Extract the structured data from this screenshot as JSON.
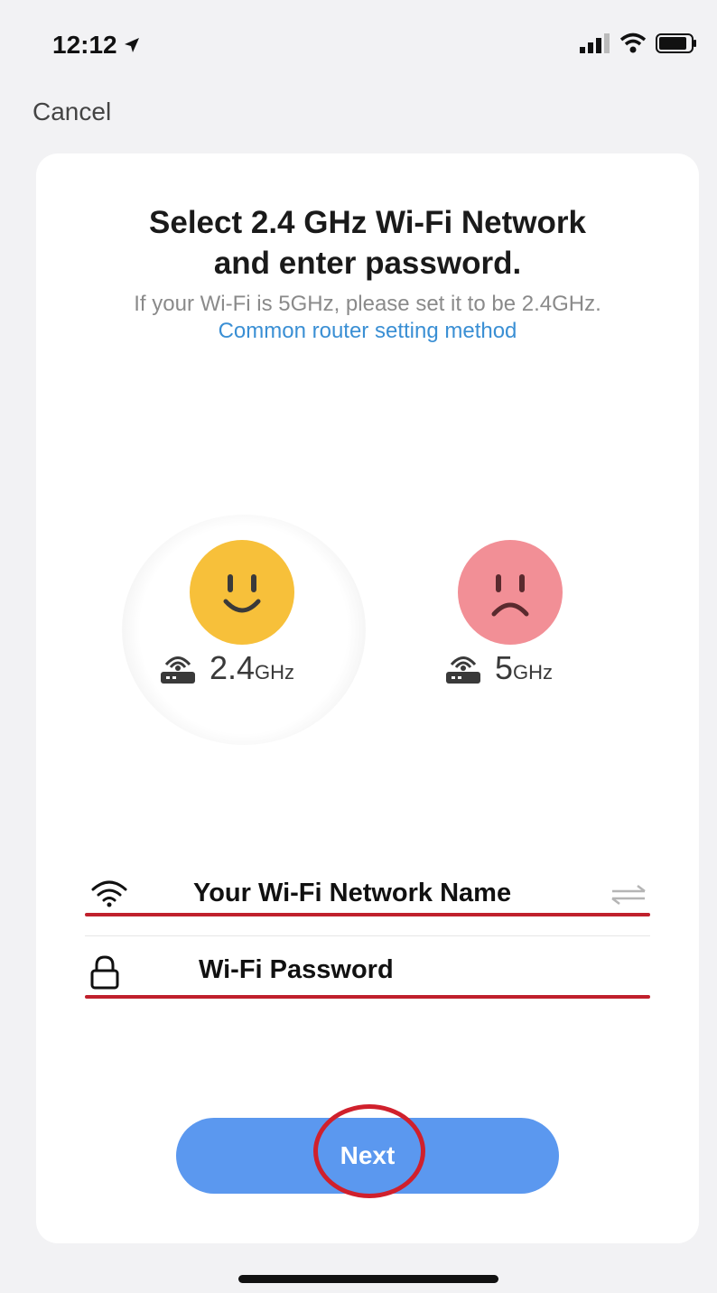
{
  "status_bar": {
    "time": "12:12",
    "icons": [
      "location-arrow-icon",
      "cellular-signal-icon",
      "wifi-icon",
      "battery-icon"
    ]
  },
  "nav": {
    "cancel_label": "Cancel"
  },
  "card": {
    "title_line1": "Select 2.4 GHz Wi-Fi Network",
    "title_line2": "and enter password.",
    "subtitle_text": "If your Wi-Fi is 5GHz, please set it to be 2.4GHz.",
    "subtitle_link": "Common router setting method",
    "bands": [
      {
        "value": "2.4",
        "unit": "GHz",
        "face": "happy",
        "color": "#f7c03a"
      },
      {
        "value": "5",
        "unit": "GHz",
        "face": "sad",
        "color": "#f28f96"
      }
    ],
    "ssid_field": {
      "value": "Your Wi-Fi Network Name",
      "icon": "wifi-icon",
      "action_icon": "swap-arrows-icon"
    },
    "password_field": {
      "value": "Wi-Fi Password",
      "icon": "lock-icon"
    },
    "next_label": "Next"
  },
  "colors": {
    "accent": "#5b98ef",
    "link": "#3a8fd4",
    "annotation": "#c0202c"
  }
}
